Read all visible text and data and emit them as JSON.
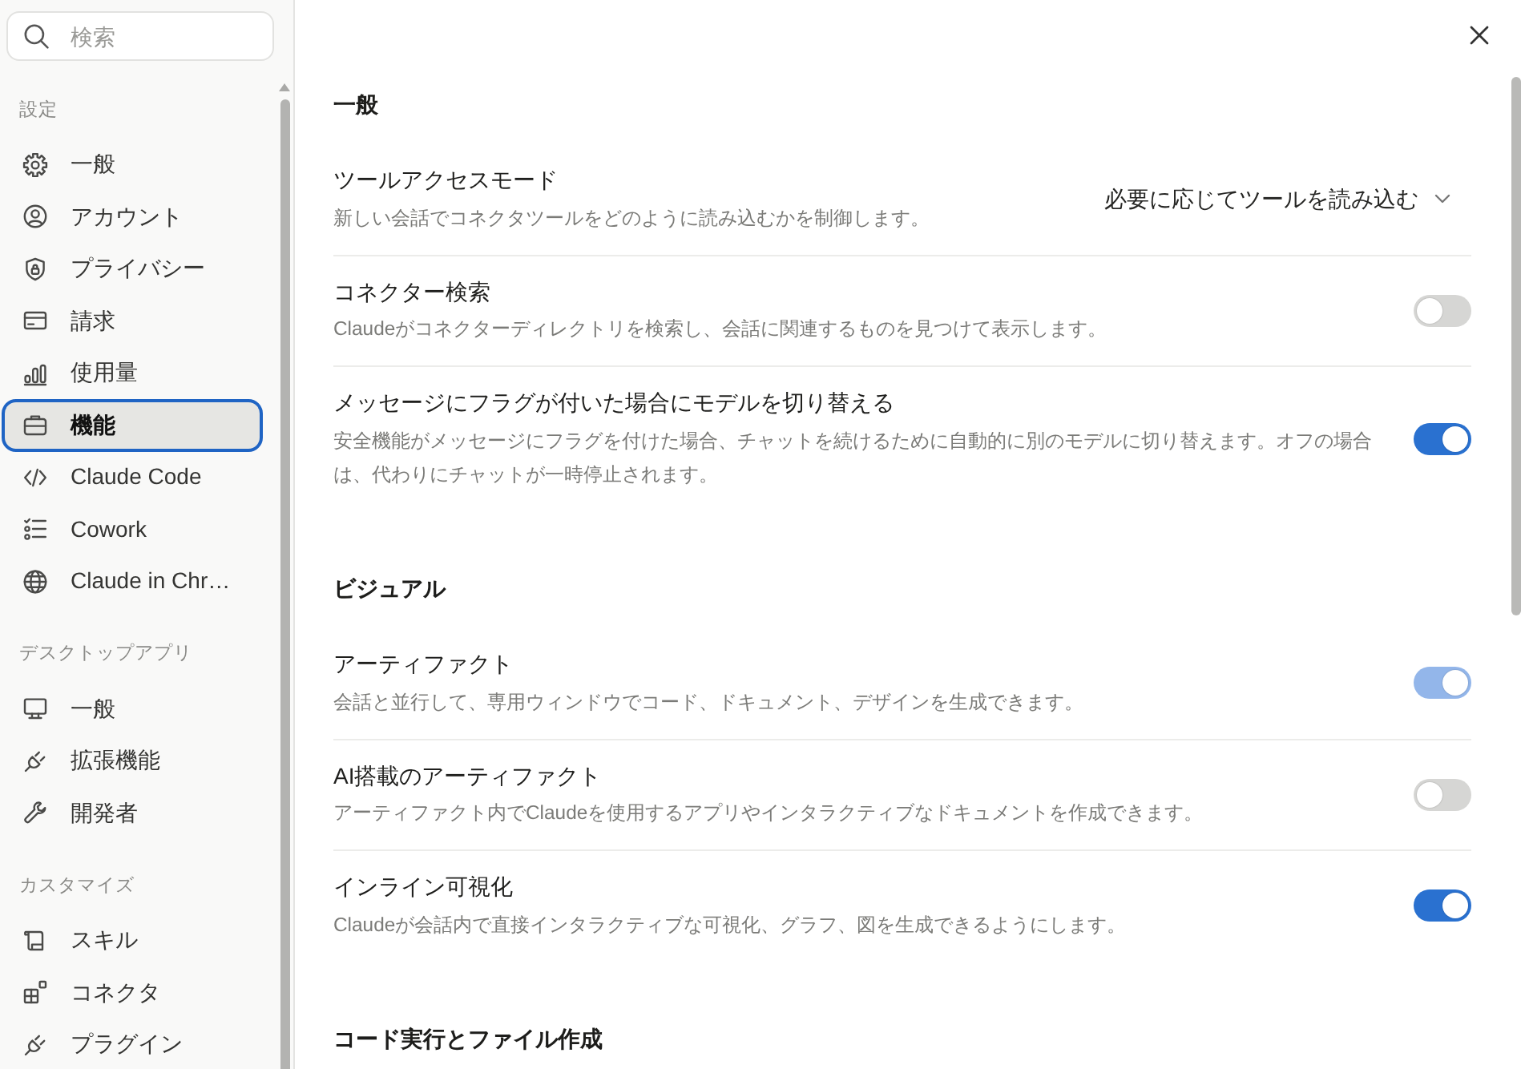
{
  "sidebar": {
    "search": {
      "placeholder": "検索"
    },
    "sections": [
      {
        "heading": "設定",
        "items": [
          {
            "label": "一般",
            "selected": false
          },
          {
            "label": "アカウント",
            "selected": false
          },
          {
            "label": "プライバシー",
            "selected": false
          },
          {
            "label": "請求",
            "selected": false
          },
          {
            "label": "使用量",
            "selected": false
          },
          {
            "label": "機能",
            "selected": true
          },
          {
            "label": "Claude Code",
            "selected": false
          },
          {
            "label": "Cowork",
            "selected": false
          },
          {
            "label": "Claude in Chr…",
            "selected": false
          }
        ]
      },
      {
        "heading": "デスクトップアプリ",
        "items": [
          {
            "label": "一般",
            "selected": false
          },
          {
            "label": "拡張機能",
            "selected": false
          },
          {
            "label": "開発者",
            "selected": false
          }
        ]
      },
      {
        "heading": "カスタマイズ",
        "items": [
          {
            "label": "スキル",
            "selected": false
          },
          {
            "label": "コネクタ",
            "selected": false
          },
          {
            "label": "プラグイン",
            "selected": false
          }
        ]
      }
    ]
  },
  "settings": {
    "sections": [
      {
        "heading": "一般",
        "rows": [
          {
            "kind": "select",
            "title": "ツールアクセスモード",
            "description": "新しい会話でコネクタツールをどのように読み込むかを制御します。",
            "value": "必要に応じてツールを読み込む"
          },
          {
            "kind": "toggle",
            "title": "コネクター検索",
            "description": "Claudeがコネクターディレクトリを検索し、会話に関連するものを見つけて表示します。",
            "on": false,
            "disabled": false
          },
          {
            "kind": "toggle",
            "title": "メッセージにフラグが付いた場合にモデルを切り替える",
            "description": "安全機能がメッセージにフラグを付けた場合、チャットを続けるために自動的に別のモデルに切り替えます。オフの場合は、代わりにチャットが一時停止されます。",
            "on": true,
            "disabled": false
          }
        ]
      },
      {
        "heading": "ビジュアル",
        "rows": [
          {
            "kind": "toggle",
            "title": "アーティファクト",
            "description": "会話と並行して、専用ウィンドウでコード、ドキュメント、デザインを生成できます。",
            "on": true,
            "disabled": true
          },
          {
            "kind": "toggle",
            "title": "AI搭載のアーティファクト",
            "description": "アーティファクト内でClaudeを使用するアプリやインタラクティブなドキュメントを作成できます。",
            "on": false,
            "disabled": false
          },
          {
            "kind": "toggle",
            "title": "インライン可視化",
            "description": "Claudeが会話内で直接インタラクティブな可視化、グラフ、図を生成できるようにします。",
            "on": true,
            "disabled": false
          }
        ]
      },
      {
        "heading": "コード実行とファイル作成"
      }
    ]
  }
}
